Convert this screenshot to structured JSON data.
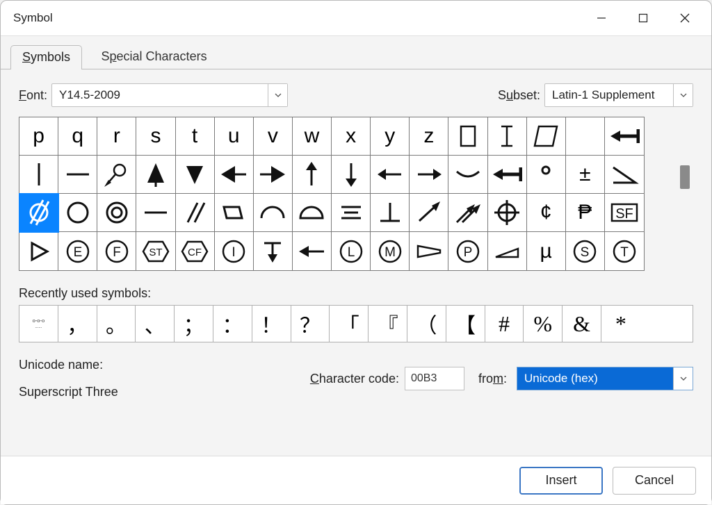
{
  "window": {
    "title": "Symbol"
  },
  "tabs": {
    "symbols": "Symbols",
    "special": "Special Characters"
  },
  "font": {
    "label": "Font:",
    "value": "Y14.5-2009"
  },
  "subset": {
    "label": "Subset:",
    "value": "Latin-1 Supplement"
  },
  "grid": {
    "row0": [
      "p",
      "q",
      "r",
      "s",
      "t",
      "u",
      "v",
      "w",
      "x",
      "y",
      "z",
      "rect",
      "text-cursor",
      "parallelogram-outline",
      "blank",
      "arrow-left-stop"
    ],
    "row1": [
      "vline",
      "hline",
      "datum-target",
      "cone-filled",
      "triangle-down-filled",
      "arrow-left-filled",
      "arrow-right-filled",
      "arrow-up",
      "arrow-down",
      "arrow-left",
      "arrow-right",
      "arc-down",
      "arrow-left-stop",
      "degree",
      "plus-minus",
      "angle"
    ],
    "row2": [
      "cylindricity",
      "circle",
      "concentricity",
      "straightness",
      "parallelism",
      "flatness",
      "profile-line",
      "profile-surface",
      "symmetry",
      "perpendicularity",
      "runout",
      "total-runout",
      "position",
      "cent",
      "capital-p-stroke",
      "sf-box"
    ],
    "row3": [
      "play-triangle",
      "circled-e",
      "circled-f",
      "st-hexagon",
      "cf-hexagon",
      "circled-i",
      "t-down",
      "arrow-left-solid",
      "circled-l",
      "circled-m",
      "taper",
      "circled-p",
      "slope",
      "mu",
      "circled-s",
      "circled-t"
    ],
    "selected": [
      2,
      0
    ]
  },
  "recent": {
    "label": "Recently used symbols:",
    "items": [
      "glasses",
      "，",
      "。",
      "、",
      "；",
      "：",
      "！",
      "？",
      "「",
      "『",
      "（",
      "【",
      "#",
      "%",
      "&",
      "*"
    ]
  },
  "unicode": {
    "label": "Unicode name:",
    "name": "Superscript Three"
  },
  "charcode": {
    "label": "Character code:",
    "value": "00B3"
  },
  "from": {
    "label": "from:",
    "value": "Unicode (hex)"
  },
  "footer": {
    "insert": "Insert",
    "cancel": "Cancel"
  }
}
